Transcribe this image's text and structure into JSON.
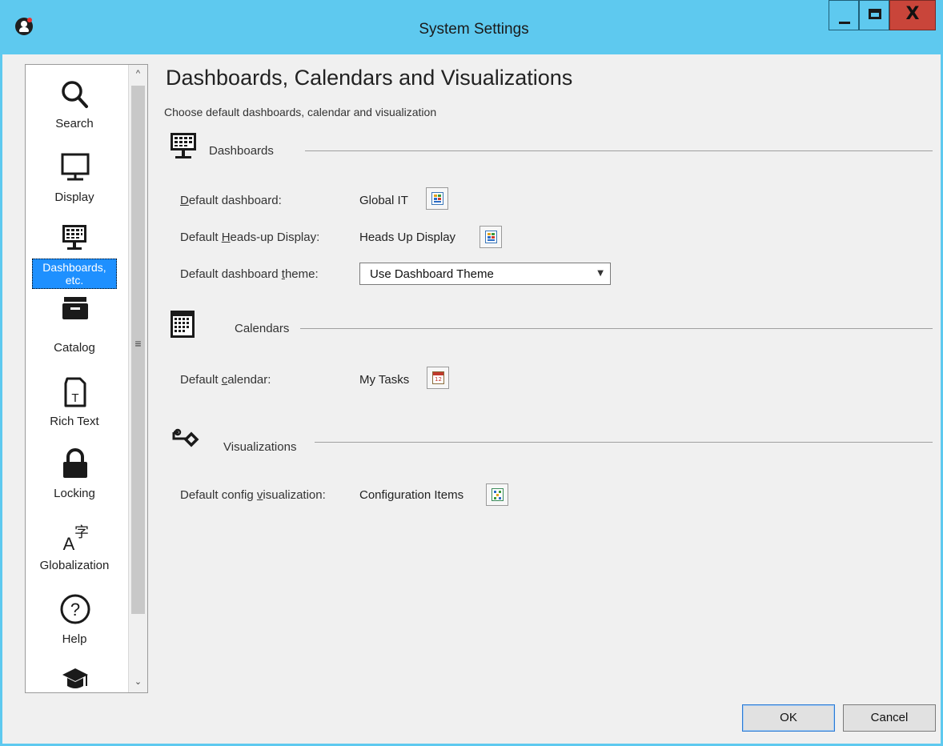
{
  "window": {
    "title": "System Settings",
    "close_glyph": "X",
    "titlebar_color": "#5ec9ef"
  },
  "sidebar": {
    "items": [
      {
        "label": "Search",
        "icon": "search-icon",
        "selected": false
      },
      {
        "label": "Display",
        "icon": "monitor-icon",
        "selected": false
      },
      {
        "label": "Dashboards, etc.",
        "icon": "dashboard-icon",
        "selected": true
      },
      {
        "label": "Catalog",
        "icon": "catalog-icon",
        "selected": false
      },
      {
        "label": "Rich Text",
        "icon": "rich-text-icon",
        "selected": false
      },
      {
        "label": "Locking",
        "icon": "lock-icon",
        "selected": false
      },
      {
        "label": "Globalization",
        "icon": "globalization-icon",
        "selected": false
      },
      {
        "label": "Help",
        "icon": "help-icon",
        "selected": false
      },
      {
        "label": "",
        "icon": "training-icon",
        "selected": false
      }
    ],
    "selected_color": "#1e90ff"
  },
  "main": {
    "title": "Dashboards, Calendars and Visualizations",
    "subtitle": "Choose default dashboards, calendar and visualization",
    "groups": {
      "dashboards": {
        "title": "Dashboards",
        "rows": {
          "default_dashboard": {
            "label_pre": "",
            "label_key": "D",
            "label_post": "efault dashboard:",
            "value": "Global IT"
          },
          "default_hud": {
            "label_pre": "Default ",
            "label_key": "H",
            "label_post": "eads-up Display:",
            "value": "Heads Up Display"
          },
          "default_theme": {
            "label_pre": "Default dashboard ",
            "label_key": "t",
            "label_post": "heme:",
            "value": "Use Dashboard Theme"
          }
        }
      },
      "calendars": {
        "title": "Calendars",
        "rows": {
          "default_calendar": {
            "label_pre": "Default ",
            "label_key": "c",
            "label_post": "alendar:",
            "value": "My Tasks"
          }
        }
      },
      "visualizations": {
        "title": "Visualizations",
        "rows": {
          "default_config_vis": {
            "label_pre": "Default config ",
            "label_key": "v",
            "label_post": "isualization:",
            "value": "Configuration Items"
          }
        }
      }
    }
  },
  "footer": {
    "ok_label": "OK",
    "cancel_label": "Cancel"
  }
}
